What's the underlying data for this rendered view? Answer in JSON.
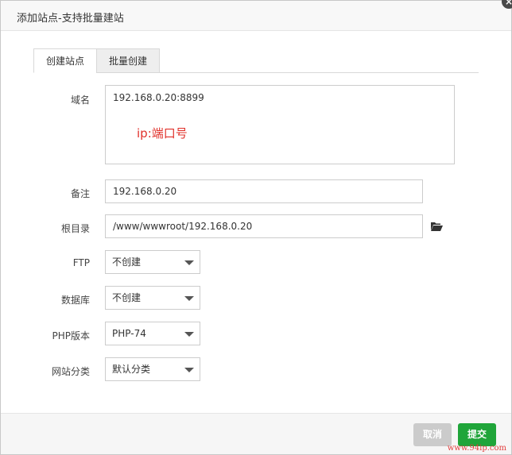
{
  "dialog": {
    "title": "添加站点-支持批量建站"
  },
  "tabs": [
    {
      "label": "创建站点",
      "active": true
    },
    {
      "label": "批量创建",
      "active": false
    }
  ],
  "form": {
    "domain": {
      "label": "域名",
      "value": "192.168.0.20:8899",
      "hint": "ip:端口号"
    },
    "note": {
      "label": "备注",
      "value": "192.168.0.20"
    },
    "root": {
      "label": "根目录",
      "value": "/www/wwwroot/192.168.0.20"
    },
    "ftp": {
      "label": "FTP",
      "selected": "不创建"
    },
    "database": {
      "label": "数据库",
      "selected": "不创建"
    },
    "php": {
      "label": "PHP版本",
      "selected": "PHP-74"
    },
    "category": {
      "label": "网站分类",
      "selected": "默认分类"
    }
  },
  "footer": {
    "cancel_label": "取消",
    "submit_label": "提交"
  },
  "watermark": "www.94ip.com",
  "colors": {
    "submit": "#20a53a",
    "cancel": "#cbcbcb",
    "hint": "#e0302a"
  }
}
